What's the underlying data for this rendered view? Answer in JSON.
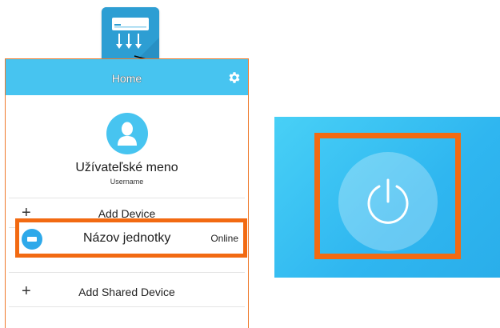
{
  "header": {
    "title": "Home"
  },
  "profile": {
    "name": "Užívateľské meno",
    "username_label": "Username"
  },
  "menu": {
    "add_device": "Add Device",
    "add_shared_device": "Add Shared Device"
  },
  "device": {
    "name": "Názov jednotky",
    "status": "Online"
  },
  "icons": {
    "app": "air-conditioner-app-icon",
    "settings": "gear-icon",
    "avatar": "user-icon",
    "device": "air-conditioner-icon",
    "power": "power-icon"
  },
  "colors": {
    "header_bg": "#47c4f0",
    "highlight": "#f26a12",
    "power_panel": "#33bdf2"
  }
}
